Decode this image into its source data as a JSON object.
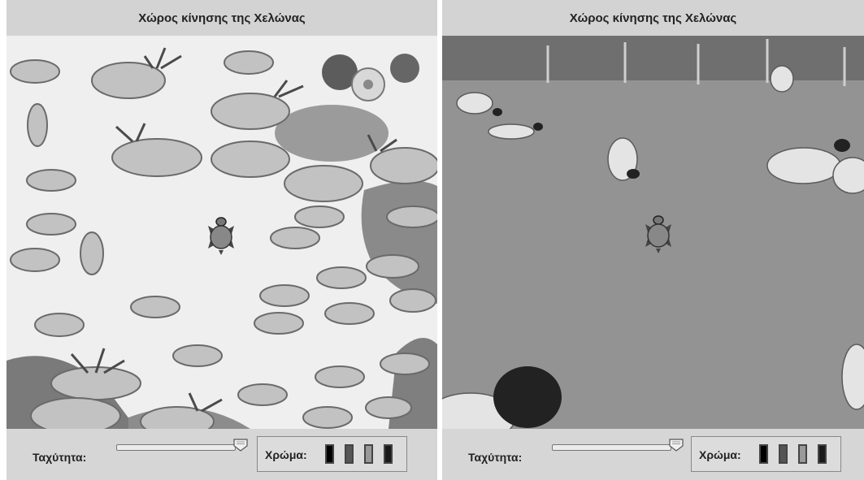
{
  "panels": [
    {
      "title": "Χώρος κίνησης της Χελώνας",
      "speed_label": "Ταχύτητα:",
      "color_label": "Χρώμα:",
      "speed_value": 1.0
    },
    {
      "title": "Χώρος κίνησης της Χελώνας",
      "speed_label": "Ταχύτητα:",
      "color_label": "Χρώμα:",
      "speed_value": 1.0
    }
  ],
  "swatch_colors": [
    "#000000",
    "#555555",
    "#999999",
    "#1a1a1a"
  ],
  "icons": {
    "turtle": "turtle-icon",
    "slider_thumb": "slider-thumb-icon"
  }
}
